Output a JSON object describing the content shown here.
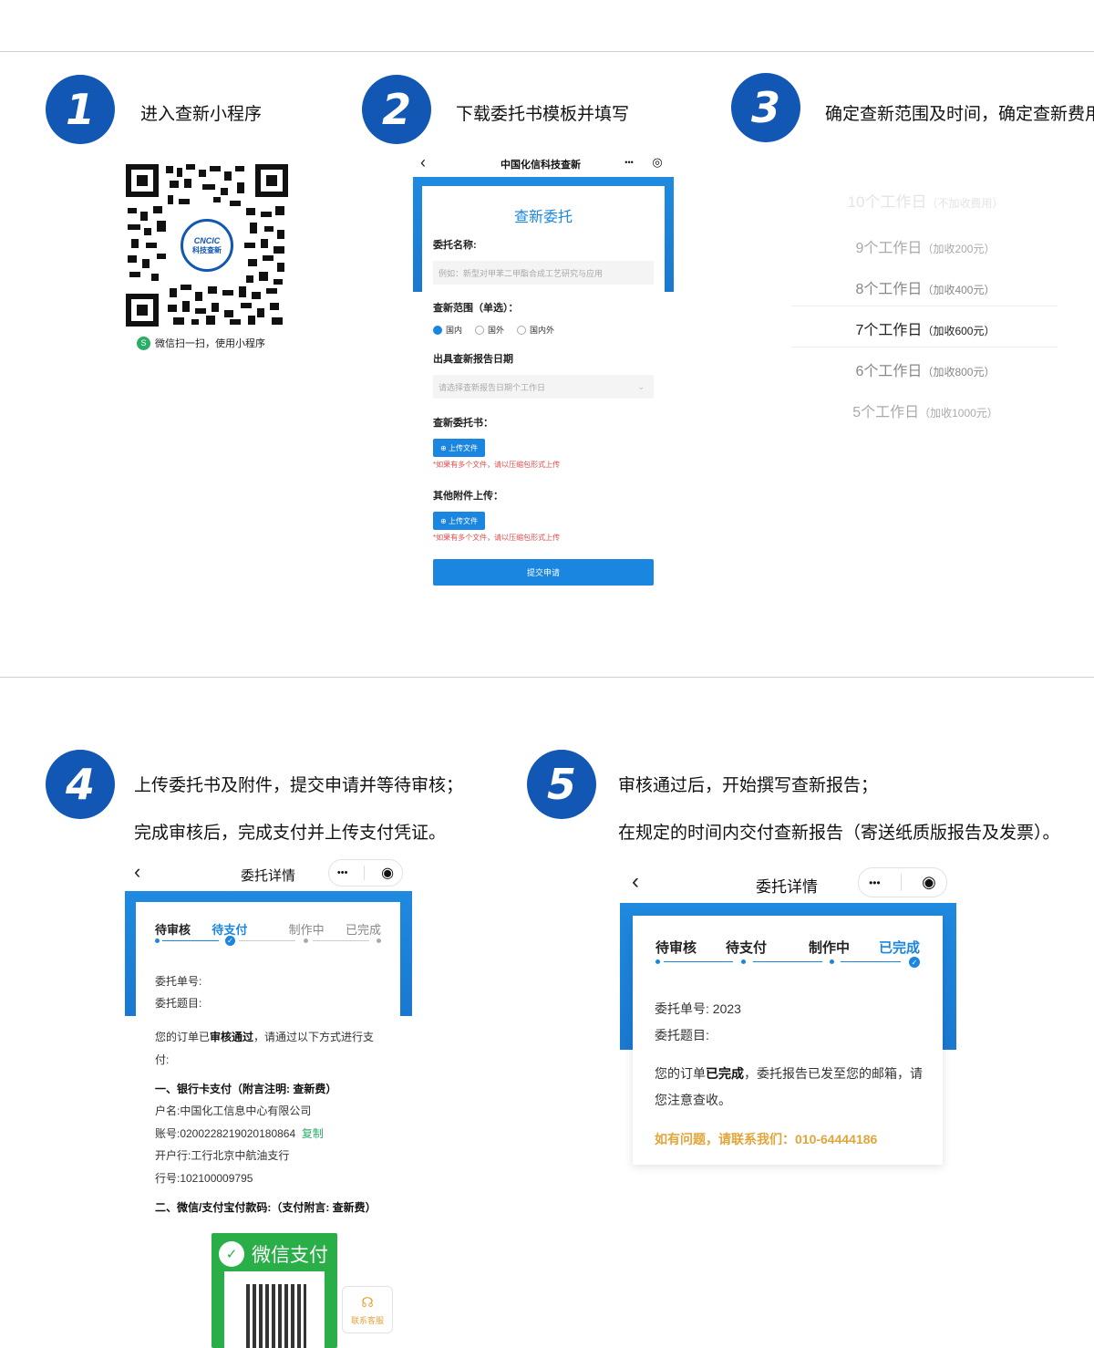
{
  "steps": [
    {
      "number": "1",
      "lines": [
        "进入查新小程序"
      ]
    },
    {
      "number": "2",
      "lines": [
        "下载委托书模板并填写"
      ]
    },
    {
      "number": "3",
      "lines": [
        "确定查新范围及时间，确定查新费用"
      ]
    },
    {
      "number": "4",
      "lines": [
        "上传委托书及附件，提交申请并等待审核；",
        "完成审核后，完成支付并上传支付凭证。"
      ]
    },
    {
      "number": "5",
      "lines": [
        "审核通过后，开始撰写查新报告；",
        "在规定的时间内交付查新报告（寄送纸质版报告及发票）。"
      ]
    }
  ],
  "qr": {
    "logo_line1": "CNCIC",
    "logo_line2": "科技查新",
    "caption": "微信扫一扫，使用小程序"
  },
  "form": {
    "nav_title": "中国化信科技查新",
    "capsule_more": "•••",
    "capsule_close": "◎",
    "heading": "查新委托",
    "name_label": "委托名称:",
    "name_placeholder": "例如：新型对甲苯二甲酯合成工艺研究与应用",
    "scope_label": "查新范围（单选）：",
    "scope_options": [
      "国内",
      "国外",
      "国内外"
    ],
    "date_label": "出具查新报告日期",
    "date_placeholder": "请选择查新报告日期个工作日",
    "letter_label": "查新委托书：",
    "upload_label": "上传文件",
    "upload_hint": "*如果有多个文件，请以压缩包形式上传",
    "attach_label": "其他附件上传：",
    "submit_label": "提交申请"
  },
  "picker": {
    "items": [
      {
        "days": "10个工作日",
        "fee": "（不加收费用）"
      },
      {
        "days": "9个工作日",
        "fee": "（加收200元）"
      },
      {
        "days": "8个工作日",
        "fee": "（加收400元）"
      },
      {
        "days": "7个工作日",
        "fee": "（加收600元）"
      },
      {
        "days": "6个工作日",
        "fee": "（加收800元）"
      },
      {
        "days": "5个工作日",
        "fee": "（加收1000元）"
      }
    ]
  },
  "detail4": {
    "nav_title": "委托详情",
    "tabs": [
      "待审核",
      "待支付",
      "制作中",
      "已完成"
    ],
    "order_no_label": "委托单号:",
    "order_title_label": "委托题目:",
    "notice_pre": "您的订单已",
    "notice_bold": "审核通过",
    "notice_post": "，请通过以下方式进行支",
    "notice_line2": "付:",
    "bank_heading": "一、银行卡支付（附言注明: 查新费）",
    "account_name": "户名:中国化工信息中心有限公司",
    "account_no": "账号:0200228219020180864",
    "copy_label": "复制",
    "bank_branch": "开户行:工行北京中航油支行",
    "bank_code": "行号:102100009795",
    "wechat_heading": "二、微信/支付宝付款码:（支付附言: 查新费）",
    "wechat_pay": "微信支付",
    "service_label": "联系客服"
  },
  "detail5": {
    "nav_title": "委托详情",
    "tabs": [
      "待审核",
      "待支付",
      "制作中",
      "已完成"
    ],
    "order_no_label": "委托单号:",
    "order_no_value": "2023",
    "order_title_label": "委托题目:",
    "notice_pre": "您的订单",
    "notice_bold": "已完成",
    "notice_post": "，委托报告已发至您的邮箱，请",
    "notice_line2": "您注意查收。",
    "contact": "如有问题，请联系我们：010-64444186"
  },
  "colors": {
    "brand": "#1157b3",
    "accent": "#1a86e0",
    "warn": "#e24c4c",
    "gold": "#e2a53a",
    "green": "#2aae48"
  }
}
